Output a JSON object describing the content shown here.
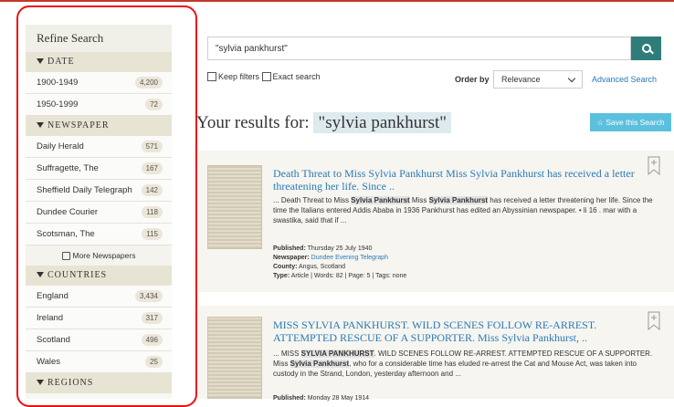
{
  "sidebar": {
    "title": "Refine Search",
    "date_heading": "DATE",
    "date_items": [
      {
        "label": "1900-1949",
        "count": "4,200"
      },
      {
        "label": "1950-1999",
        "count": "72"
      }
    ],
    "newspaper_heading": "NEWSPAPER",
    "newspaper_items": [
      {
        "label": "Daily Herald",
        "count": "571"
      },
      {
        "label": "Suffragette, The",
        "count": "167"
      },
      {
        "label": "Sheffield Daily Telegraph",
        "count": "142"
      },
      {
        "label": "Dundee Courier",
        "count": "118"
      },
      {
        "label": "Scotsman, The",
        "count": "115"
      }
    ],
    "more_label": "More Newspapers",
    "countries_heading": "COUNTRIES",
    "country_items": [
      {
        "label": "England",
        "count": "3,434"
      },
      {
        "label": "Ireland",
        "count": "317"
      },
      {
        "label": "Scotland",
        "count": "496"
      },
      {
        "label": "Wales",
        "count": "25"
      }
    ],
    "regions_heading": "REGIONS"
  },
  "search": {
    "value": "\"sylvia pankhurst\"",
    "keep_filters": "Keep filters",
    "exact_search": "Exact search",
    "order_by": "Order by",
    "order_value": "Relevance",
    "advanced": "Advanced Search"
  },
  "results": {
    "heading": "Your results for:",
    "query": "\"sylvia pankhurst\"",
    "save_label": "Save this Search",
    "items": [
      {
        "title": "Death Threat to Miss Sylvia Pankhurst Miss Sylvia Pankhurst has received a letter threatening her life. Since ..",
        "s1": "... Death Threat to Miss ",
        "h1": "Sylvia Pankhurst",
        "s2": " Miss ",
        "h2": "Sylvia Pankhurst",
        "s3": " has received a letter threatening her life. Since the time the Italians entered Addis Ababa in 1936 Pankhurst has edited an Abyssinian newspaper. • li 16 . mar with a swastika, said that if ...",
        "published_label": "Published:",
        "published": "Thursday 25 July 1940",
        "newspaper_label": "Newspaper:",
        "newspaper": "Dundee Evening Telegraph",
        "county_label": "County:",
        "county": "Angus, Scotland",
        "type_line": "Article | Words: 82 | Page: 5 | Tags: none"
      },
      {
        "title": "MISS SYLVIA PANKHURST. WILD SCENES FOLLOW RE-ARREST. ATTEMPTED RESCUE OF A SUPPORTER. Miss Sylvia Pankhurst, ..",
        "s1": "... MISS ",
        "h1": "SYLVIA PANKHURST",
        "s2": ". WILD SCENES FOLLOW RE-ARREST. ATTEMPTED RESCUE OF A SUPPORTER. Miss ",
        "h2": "Sylvia Pankhurst",
        "s3": ", who for a considerable time has eluded re-arrest the Cat and Mouse Act, was taken into custody in the Strand, London, yesterday afternoon and ...",
        "published_label": "Published:",
        "published": "Monday 28 May 1914"
      }
    ]
  }
}
